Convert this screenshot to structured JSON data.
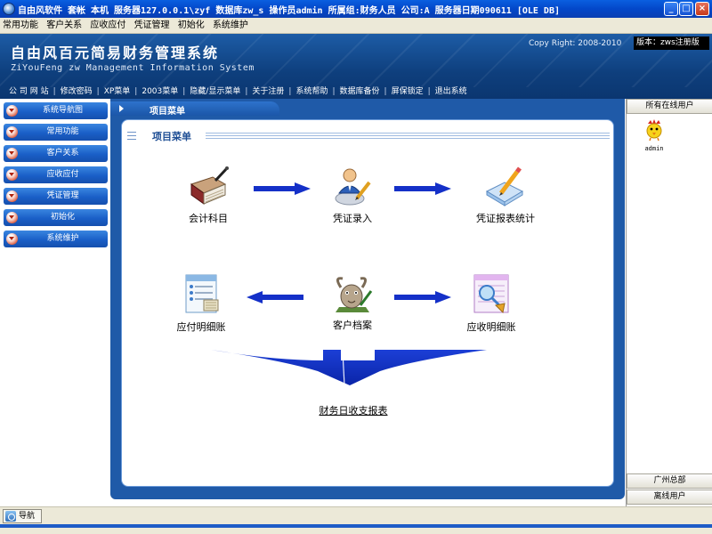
{
  "window": {
    "title": "自由风软件  套帐 本机  服务器127.0.0.1\\zyf  数据库zw_s  操作员admin  所属组:财务人员  公司:A  服务器日期090611 [OLE DB]",
    "min_label": "_",
    "max_label": "□",
    "close_label": "×"
  },
  "menubar": {
    "items": [
      "常用功能",
      "客户关系",
      "应收应付",
      "凭证管理",
      "初始化",
      "系统维护"
    ]
  },
  "header": {
    "title": "自由风百元简易财务管理系统",
    "subtitle": "ZiYouFeng zw Management Information System",
    "copyright": "Copy Right: 2008-2010",
    "version": "版本：zws注册版",
    "links": [
      "公 司 网 站",
      "修改密码",
      "XP菜单",
      "2003菜单",
      "隐藏/显示菜单",
      "关于注册",
      "系统帮助",
      "数据库备份",
      "屏保锁定",
      "退出系统"
    ]
  },
  "sidebar": {
    "items": [
      "系统导航图",
      "常用功能",
      "客户关系",
      "应收应付",
      "凭证管理",
      "初始化",
      "系统维护"
    ]
  },
  "main": {
    "tab_title": "项目菜单",
    "panel_title": "项目菜单",
    "flow": {
      "accounting_subjects": "会计科目",
      "voucher_entry": "凭证录入",
      "voucher_report": "凭证报表统计",
      "payable_detail": "应付明细账",
      "customer_records": "客户档案",
      "receivable_detail": "应收明细账",
      "daily_report": "财务日收支报表"
    }
  },
  "rightpanel": {
    "online_title": "所有在线用户",
    "users": [
      "admin"
    ],
    "guangzhou_hq": "广州总部",
    "offline_users": "离线用户"
  },
  "statusbar": {
    "tab_label": "导航"
  },
  "colors": {
    "titlebar": "#0347c9",
    "banner": "#0e3f7d",
    "sidebar_item": "#1a5fc7",
    "panel_border": "#1f5aa8",
    "arrow": "#1430c8"
  },
  "icons": {
    "app": "app-globe-icon",
    "book": "ledger-book-icon",
    "user_edit": "user-pen-icon",
    "report": "report-pen-icon",
    "payable": "list-document-icon",
    "customer": "customer-goat-icon",
    "receivable": "magnifier-document-icon",
    "online_user": "chick-user-icon"
  }
}
